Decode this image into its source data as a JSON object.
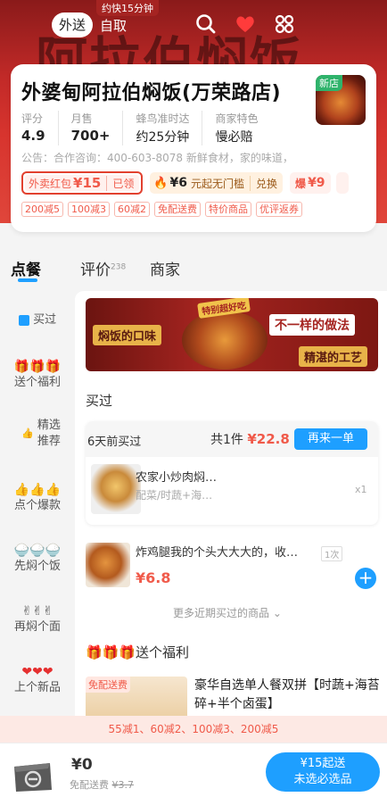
{
  "topbar": {
    "mode_active": "外送",
    "mode_other": "自取",
    "speed_tag": "约快15分钟",
    "icons": [
      "search-icon",
      "heart-icon",
      "more-icon"
    ]
  },
  "banner_art": "阿拉伯焖饭",
  "store": {
    "name": "外婆甸阿拉伯焖饭(万荣路店)",
    "new_tag": "新店",
    "stats": [
      {
        "label": "评分",
        "value": "4.9"
      },
      {
        "label": "月售",
        "value": "700+"
      },
      {
        "label": "蜂鸟准时达",
        "value": "约25分钟"
      },
      {
        "label": "商家特色",
        "value": "慢必赔"
      }
    ],
    "notice": "公告：合作咨询：400-603-8078 新鲜食材，家的味道，"
  },
  "promos": {
    "redpacket": {
      "label": "外卖红包",
      "amount": "¥15",
      "button": "已领"
    },
    "coupon2": {
      "amount": "¥6",
      "desc": "元起无门槛",
      "button": "兑换"
    },
    "coupon3": {
      "amount": "¥9"
    },
    "tags": [
      "200减5",
      "100减3",
      "60减2",
      "免配送费",
      "特价商品",
      "优评返券"
    ]
  },
  "tabs": [
    {
      "label": "点餐"
    },
    {
      "label": "评价",
      "badge": "238"
    },
    {
      "label": "商家"
    }
  ],
  "sidebar": [
    {
      "emoji": "▪",
      "label": "买过"
    },
    {
      "emoji": "🎁🎁🎁",
      "label": "送个福利"
    },
    {
      "emoji": "👍",
      "label": "精选推荐"
    },
    {
      "emoji": "👍👍👍",
      "label": "点个爆款"
    },
    {
      "emoji": "🍚🍚🍚",
      "label": "先焖个饭"
    },
    {
      "emoji": "✌✌✌",
      "label": "再焖个面"
    },
    {
      "emoji": "❤❤❤",
      "label": "上个新品"
    }
  ],
  "promo_banner": {
    "tag": "特别超好吃",
    "left": "焖饭的口味",
    "right_top": "不一样的做法",
    "right_bottom": "精湛的工艺"
  },
  "bought": {
    "title": "买过",
    "time": "6天前买过",
    "total_prefix": "共1件",
    "total_price": "¥22.8",
    "reorder": "再来一单",
    "item_name": "农家小炒肉焖…",
    "item_sub": "配菜/时蔬+海…",
    "item_qty": "x1"
  },
  "item2": {
    "name": "炸鸡腿我的个头大大大的，收…",
    "count": "1次",
    "price": "¥6.8"
  },
  "more_link": "更多近期买过的商品 ⌄",
  "welfare_title": "🎁🎁🎁送个福利",
  "item3": {
    "free_tag": "免配送费",
    "name": "豪华自选单人餐双拼【时蔬+海苔碎+半个卤蛋】"
  },
  "discount_strip": "55减1、60减2、100减3、200减5",
  "cart": {
    "price": "¥0",
    "sub_prefix": "免配送费",
    "sub_strike": "¥3.7",
    "checkout_line1": "¥15起送",
    "checkout_line2": "未选必选品"
  },
  "colors": {
    "accent_blue": "#1e9fff",
    "price_red": "#f05a4a",
    "banner_red": "#c22a28"
  }
}
